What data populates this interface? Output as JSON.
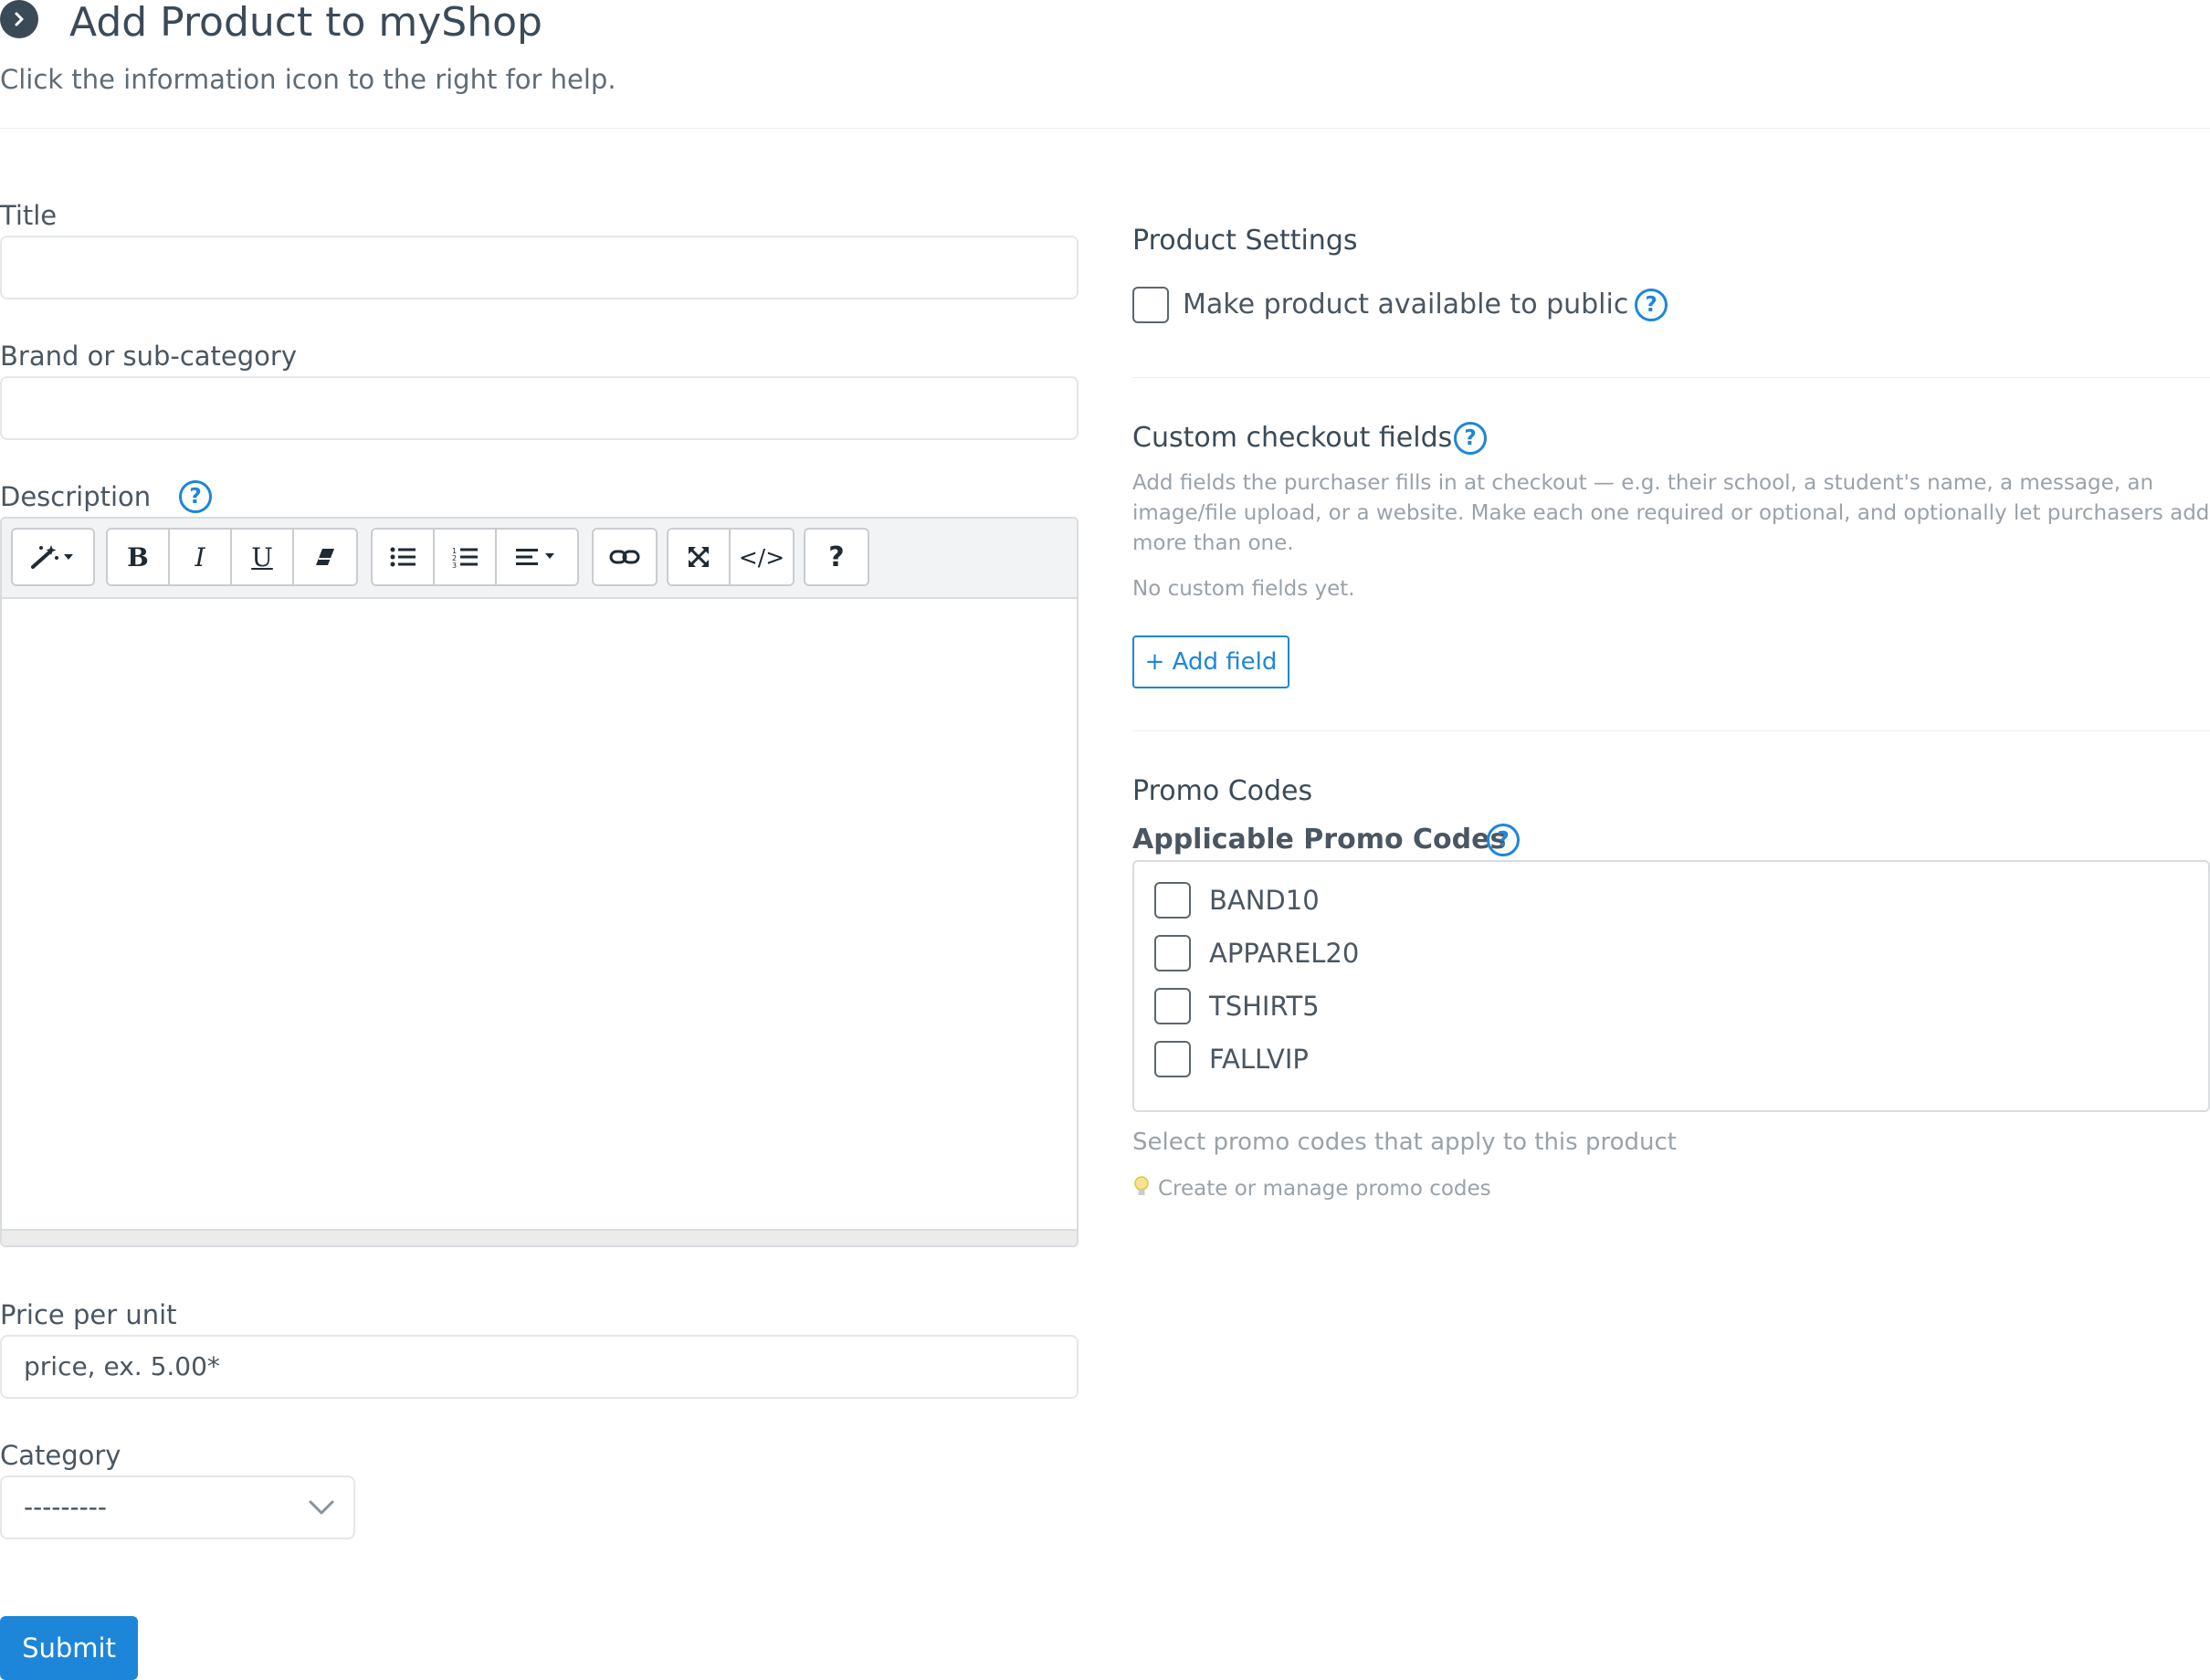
{
  "header": {
    "chevron_icon": "chevron-right-icon",
    "title": "Add Product to myShop",
    "subtitle": "Click the information icon to the right for help."
  },
  "form": {
    "title": {
      "label": "Title",
      "value": ""
    },
    "brand": {
      "label": "Brand or sub-category",
      "value": ""
    },
    "description": {
      "label": "Description",
      "help_icon": "?",
      "toolbar": {
        "style_icon": "magic-wand-icon",
        "bold": "B",
        "italic": "I",
        "underline": "U",
        "eraser_icon": "eraser-icon",
        "ul_icon": "unordered-list-icon",
        "ol_icon": "ordered-list-icon",
        "align_icon": "align-icon",
        "link_icon": "link-icon",
        "fullscreen_icon": "fullscreen-icon",
        "code": "</>",
        "help": "?"
      },
      "value": ""
    },
    "price": {
      "label": "Price per unit",
      "placeholder": "price, ex. 5.00*"
    },
    "category": {
      "label": "Category",
      "selected": "---------"
    },
    "submit_label": "Submit"
  },
  "product_settings": {
    "heading": "Product Settings",
    "public_label": "Make product available to public",
    "public_checked": false,
    "help_icon": "?"
  },
  "custom_checkout": {
    "heading": "Custom checkout fields",
    "help_icon": "?",
    "description_line1": "Add fields the purchaser fills in at checkout — e.g. their school, a student's name, a message, an",
    "description_line2": "image/file upload, or a website. Make each one required or optional, and optionally let purchasers add",
    "description_line3": "more than one.",
    "empty_text": "No custom fields yet.",
    "add_button": "+ Add field"
  },
  "promo": {
    "heading": "Promo Codes",
    "subheading": "Applicable Promo Codes",
    "help_icon": "?",
    "codes": [
      {
        "label": "BAND10",
        "checked": false
      },
      {
        "label": "APPAREL20",
        "checked": false
      },
      {
        "label": "TSHIRT5",
        "checked": false
      },
      {
        "label": "FALLVIP",
        "checked": false
      }
    ],
    "hint": "Select promo codes that apply to this product",
    "manage_link": "Create or manage promo codes",
    "bulb_icon": "lightbulb-icon"
  },
  "colors": {
    "accent": "#1e86d8",
    "text": "#3b4a57",
    "muted": "#9aa2a9"
  }
}
